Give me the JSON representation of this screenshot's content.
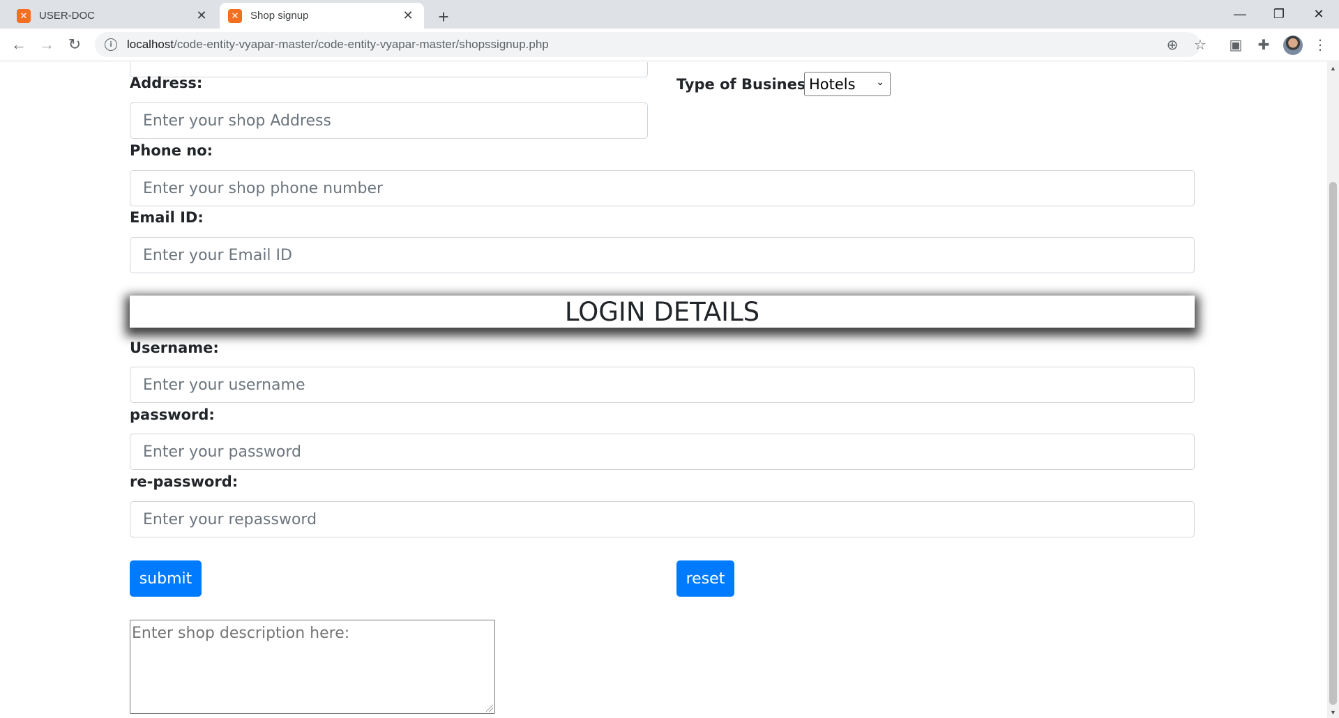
{
  "browser": {
    "tabs": [
      {
        "title": "USER-DOC",
        "favicon": "xampp-icon",
        "active": false
      },
      {
        "title": "Shop signup",
        "favicon": "xampp-icon",
        "active": true
      }
    ],
    "url_host": "localhost",
    "url_path": "/code-entity-vyapar-master/code-entity-vyapar-master/shopssignup.php"
  },
  "form": {
    "address_label": "Address:",
    "address_placeholder": "Enter your shop Address",
    "business_label": "Type of Business:",
    "business_selected": "Hotels",
    "phone_label": "Phone no:",
    "phone_placeholder": "Enter your shop phone number",
    "email_label": "Email ID:",
    "email_placeholder": "Enter your Email ID",
    "login_heading": "LOGIN DETAILS",
    "username_label": "Username:",
    "username_placeholder": "Enter your username",
    "password_label": "password:",
    "password_placeholder": "Enter your password",
    "repassword_label": "re-password:",
    "repassword_placeholder": "Enter your repassword",
    "submit_label": "submit",
    "reset_label": "reset",
    "description_placeholder": "Enter shop description here:"
  },
  "colors": {
    "primary": "#007bff",
    "text": "#212529",
    "input_border": "#ced4da"
  }
}
